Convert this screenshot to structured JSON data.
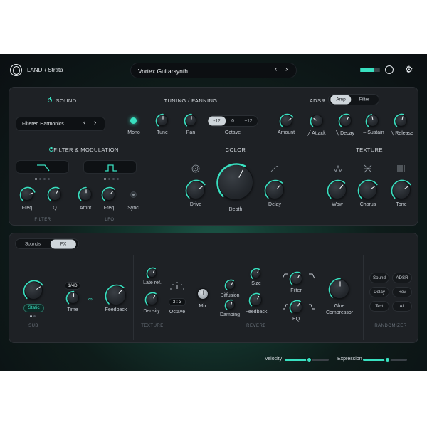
{
  "app": {
    "name": "LANDR Strata",
    "preset": "Vortex Guitarsynth"
  },
  "colors": {
    "accent": "#39e0c0",
    "panel": "#1e2125",
    "bg": "#0b0f12"
  },
  "sound": {
    "title": "SOUND",
    "preset": "Filtered Harmonics"
  },
  "tuning": {
    "title": "TUNING / PANNING",
    "mono": "Mono",
    "tune": "Tune",
    "pan": "Pan",
    "octave": "Octave",
    "octave_options": [
      "-12",
      "0",
      "+12"
    ],
    "octave_selected": "-12"
  },
  "adsr": {
    "title": "ADSR",
    "tabs": [
      "Amp",
      "Filter"
    ],
    "tab_selected": "Amp",
    "amount": "Amount",
    "attack": "Attack",
    "decay": "Decay",
    "sustain": "Sustain",
    "release": "Release"
  },
  "filter_mod": {
    "title": "FILTER & MODULATION",
    "freq": "Freq",
    "q": "Q",
    "amnt": "Amnt",
    "lfo_freq": "Freq",
    "sync": "Sync",
    "filter_section": "FILTER",
    "lfo_section": "LFO"
  },
  "color": {
    "title": "COLOR",
    "drive": "Drive",
    "depth": "Depth",
    "delay": "Delay"
  },
  "texture": {
    "title": "TEXTURE",
    "wow": "Wow",
    "chorus": "Chorus",
    "tone": "Tone"
  },
  "bottom": {
    "tabs": [
      "Sounds",
      "FX"
    ],
    "tab_selected": "FX",
    "sub": {
      "mode": "Static",
      "section": "SUB"
    },
    "delay": {
      "time_value": "1/4D",
      "time": "Time",
      "feedback": "Feedback"
    },
    "texture": {
      "late_ref": "Late ref.",
      "density": "Density",
      "octave": "Octave",
      "octave_value": "3 : 3",
      "mix": "Mix",
      "section": "TEXTURE"
    },
    "reverb": {
      "diffusion": "Diffusion",
      "damping": "Damping",
      "size": "Size",
      "feedback": "Feedback",
      "section": "REVERB"
    },
    "eq": {
      "filter": "Filter",
      "eq": "EQ"
    },
    "glue": {
      "label": "Glue\nCompressor"
    },
    "randomizer": {
      "buttons": [
        "Sound",
        "ADSR",
        "Delay",
        "Rev",
        "Text",
        "All"
      ],
      "section": "RANDOMIZER"
    }
  },
  "footer": {
    "velocity": "Velocity",
    "velocity_value": 0.55,
    "expression": "Expression",
    "expression_value": 0.55
  }
}
